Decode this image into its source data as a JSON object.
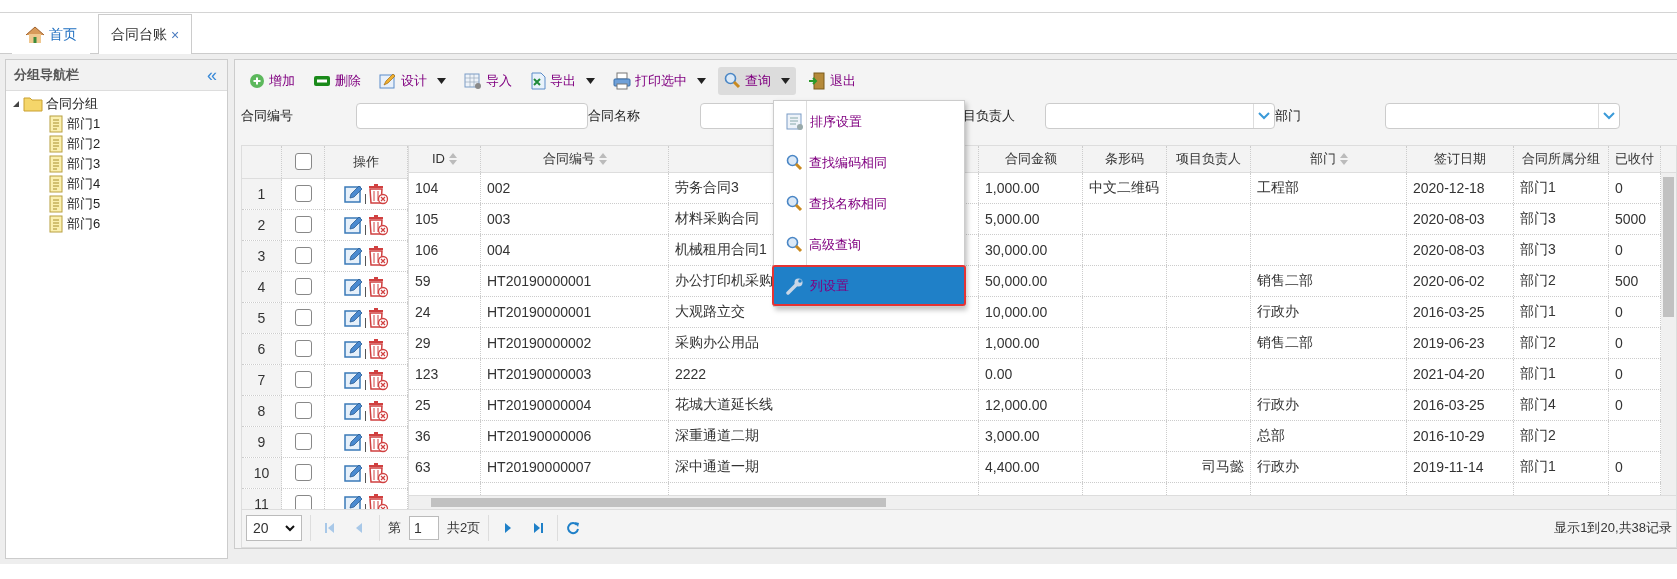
{
  "tabs": [
    {
      "label": "首页",
      "kind": "home",
      "selected": false
    },
    {
      "label": "合同台账",
      "kind": "closable",
      "close": "×",
      "selected": true
    }
  ],
  "sidebar": {
    "title": "分组导航栏",
    "collapse": "«",
    "tree": [
      {
        "label": "合同分组",
        "expanded": true,
        "children": [
          {
            "label": "部门1"
          },
          {
            "label": "部门2"
          },
          {
            "label": "部门3"
          },
          {
            "label": "部门4"
          },
          {
            "label": "部门5"
          },
          {
            "label": "部门6"
          }
        ]
      }
    ]
  },
  "toolbar": [
    {
      "label": "增加",
      "kind": "add",
      "dropdown": false,
      "pressed": false
    },
    {
      "label": "删除",
      "kind": "remove",
      "dropdown": false,
      "pressed": false
    },
    {
      "label": "设计",
      "kind": "design",
      "dropdown": true,
      "pressed": false
    },
    {
      "label": "导入",
      "kind": "import",
      "dropdown": false,
      "pressed": false
    },
    {
      "label": "导出",
      "kind": "export",
      "dropdown": true,
      "pressed": false
    },
    {
      "label": "打印选中",
      "kind": "print",
      "dropdown": true,
      "pressed": false
    },
    {
      "label": "查询",
      "kind": "search",
      "dropdown": true,
      "pressed": true
    },
    {
      "label": "退出",
      "kind": "exit",
      "dropdown": false,
      "pressed": false
    }
  ],
  "search_fields": [
    {
      "label": "合同编号",
      "kind": "text"
    },
    {
      "label": "合同名称",
      "kind": "text"
    },
    {
      "label": "目负责人",
      "kind": "combo"
    },
    {
      "label": "部门",
      "kind": "combo"
    }
  ],
  "query_menu": [
    {
      "label": "排序设置",
      "kind": "sort",
      "selected": false
    },
    {
      "label": "查找编码相同",
      "kind": "search",
      "selected": false
    },
    {
      "label": "查找名称相同",
      "kind": "search",
      "selected": false
    },
    {
      "label": "高级查询",
      "kind": "search",
      "selected": false
    },
    {
      "label": "列设置",
      "kind": "wrench",
      "selected": true
    }
  ],
  "table": {
    "header_checked": false,
    "columns": [
      {
        "label": "ID",
        "sortable": true
      },
      {
        "label": "合同编号",
        "sortable": true
      },
      {},
      {
        "label": "合同金额",
        "sortable": false
      },
      {
        "label": "条形码",
        "sortable": false
      },
      {
        "label": "项目负责人",
        "sortable": false
      },
      {
        "label": "部门",
        "sortable": true
      },
      {
        "label": "签订日期",
        "sortable": false
      },
      {
        "label": "合同所属分组",
        "sortable": false
      },
      {
        "label": "已收付",
        "sortable": false
      }
    ],
    "action_column": "操作",
    "rows": [
      {
        "number": "1",
        "checked": false,
        "cells": [
          "104",
          "002",
          "劳务合同3",
          "1,000.00",
          "中文二维码",
          null,
          "工程部",
          "2020-12-18",
          "部门1",
          "0"
        ]
      },
      {
        "number": "2",
        "checked": false,
        "cells": [
          "105",
          "003",
          "材料采购合同",
          "5,000.00",
          null,
          null,
          null,
          "2020-08-03",
          "部门3",
          "5000"
        ]
      },
      {
        "number": "3",
        "checked": false,
        "cells": [
          "106",
          "004",
          "机械租用合同1",
          "30,000.00",
          null,
          null,
          null,
          "2020-08-03",
          "部门3",
          "0"
        ]
      },
      {
        "number": "4",
        "checked": false,
        "cells": [
          "59",
          "HT20190000001",
          "办公打印机采购",
          "50,000.00",
          null,
          null,
          "销售二部",
          "2020-06-02",
          "部门2",
          "500"
        ]
      },
      {
        "number": "5",
        "checked": false,
        "cells": [
          "24",
          "HT20190000001",
          "大观路立交",
          "10,000.00",
          null,
          null,
          "行政办",
          "2016-03-25",
          "部门1",
          "0"
        ]
      },
      {
        "number": "6",
        "checked": false,
        "cells": [
          "29",
          "HT20190000002",
          "采购办公用品",
          "1,000.00",
          null,
          null,
          "销售二部",
          "2019-06-23",
          "部门2",
          "0"
        ]
      },
      {
        "number": "7",
        "checked": false,
        "cells": [
          "123",
          "HT20190000003",
          "2222",
          "0.00",
          null,
          null,
          null,
          "2021-04-20",
          "部门1",
          "0"
        ]
      },
      {
        "number": "8",
        "checked": false,
        "cells": [
          "25",
          "HT20190000004",
          "花城大道延长线",
          "12,000.00",
          null,
          null,
          "行政办",
          "2016-03-25",
          "部门4",
          "0"
        ]
      },
      {
        "number": "9",
        "checked": false,
        "cells": [
          "36",
          "HT20190000006",
          "深重通道二期",
          "3,000.00",
          null,
          null,
          "总部",
          "2016-10-29",
          "部门2",
          null
        ]
      },
      {
        "number": "10",
        "checked": false,
        "cells": [
          "63",
          "HT20190000007",
          "深中通道一期",
          "4,400.00",
          null,
          "司马懿",
          "行政办",
          "2019-11-14",
          "部门1",
          "0"
        ]
      },
      {
        "number": "11",
        "checked": false
      }
    ]
  },
  "pager": {
    "page_size": "20",
    "page_prefix": "第",
    "page": "1",
    "page_suffix": "共2页",
    "first_disabled": true,
    "prev_disabled": true,
    "next_disabled": false,
    "last_disabled": false,
    "summary": "显示1到20,共38记录"
  }
}
